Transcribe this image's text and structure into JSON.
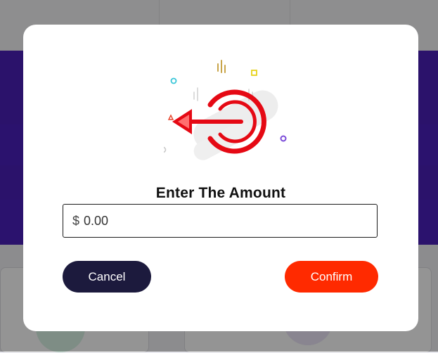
{
  "dialog": {
    "title": "Enter The Amount",
    "amount_field": {
      "currency_symbol": "$",
      "value": "0.00"
    },
    "cancel_label": "Cancel",
    "confirm_label": "Confirm",
    "illustration_icon": "logout-arrow-icon"
  },
  "colors": {
    "accent_red": "#ff2a00",
    "cancel_dark": "#1c1a3d",
    "band_purple": "#4a1fb8"
  }
}
